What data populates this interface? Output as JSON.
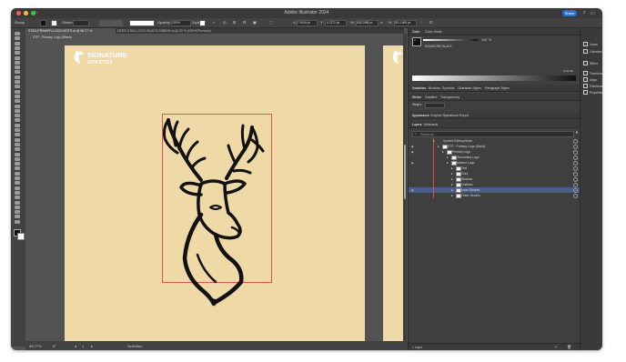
{
  "app": {
    "title": "Adobe Illustrator 2024",
    "share_label": "Share",
    "traffic_lights": [
      "#ff5f57",
      "#febc2e",
      "#28c840"
    ]
  },
  "control_bar": {
    "selection": "Group",
    "stroke_label": "Stroke:",
    "opacity_label": "Opacity:",
    "opacity_value": "100%",
    "style_label": "Style:",
    "x_label": "X:",
    "x_value": "7.0049 px",
    "y_label": "Y:",
    "y_value": "-6.2272 px",
    "w_label": "W:",
    "w_value": "518.2088 px",
    "h_label": "H:",
    "h_value": "811.1469 px"
  },
  "tabs": [
    {
      "label": "STAG-PRIMARY-LOGO-NOTE.ai @ 56.77 % (CMYK/Preview)",
      "active": true
    },
    {
      "label": "DEER-STAG-LOGO-BLACK-RIBBON.ai @ 20 % (CMYK/Preview)",
      "active": false
    }
  ],
  "artboard": {
    "label": "STP - Primary Logo (Stack)",
    "background": "#efd9a6"
  },
  "logo": {
    "brand_top": "SIGNATURE",
    "brand_bottom": "ATHLETICS"
  },
  "status": {
    "zoom": "56.77%",
    "rotation": "0°",
    "artboard_num": "1",
    "tool": "Selection"
  },
  "panel": {
    "color_tabs": [
      "Color",
      "Color Guide"
    ],
    "swatch_name": "SIGNATURE BLACK",
    "tint_label": "C",
    "tint_value": "100",
    "tint_percent": "%",
    "hex_value": "1C1F1E",
    "swatch_tabs": [
      "Swatches",
      "Brushes",
      "Symbols",
      "Character Styles",
      "Paragraph Styles"
    ],
    "stroke_tabs": [
      "Stroke",
      "Gradient",
      "Transparency"
    ],
    "weight_label": "Weight:",
    "appearance_tabs": [
      "Appearance",
      "Graphic Styles",
      "Asset Export"
    ],
    "layers_tabs": [
      "Layers",
      "Artboards"
    ],
    "search_placeholder": "Search All",
    "footer": "1 Layer"
  },
  "layers": [
    {
      "name": "Symbol Editing Mode",
      "indent": 1,
      "sel": false,
      "swatch": false,
      "eye": false
    },
    {
      "name": "STP - Primary Logo (Stack)",
      "indent": 2,
      "sel": false,
      "swatch": true,
      "eye": true
    },
    {
      "name": "Primary Logo",
      "indent": 3,
      "sel": false,
      "swatch": true,
      "eye": true
    },
    {
      "name": "Secondary Logo",
      "indent": 4,
      "sel": false,
      "swatch": true,
      "eye": false
    },
    {
      "name": "Mascot Logo",
      "indent": 4,
      "sel": false,
      "swatch": true,
      "eye": true
    },
    {
      "name": "Text",
      "indent": 5,
      "sel": false,
      "swatch": true,
      "eye": false
    },
    {
      "name": "Gold",
      "indent": 5,
      "sel": false,
      "swatch": true,
      "eye": false
    },
    {
      "name": "Shadow",
      "indent": 5,
      "sel": false,
      "swatch": true,
      "eye": false
    },
    {
      "name": "Outlines",
      "indent": 5,
      "sel": false,
      "swatch": true,
      "eye": false
    },
    {
      "name": "Inner Strokes",
      "indent": 5,
      "sel": true,
      "swatch": true,
      "eye": true
    },
    {
      "name": "Outer Strokes",
      "indent": 5,
      "sel": false,
      "swatch": true,
      "eye": false
    }
  ],
  "right_bar": [
    {
      "label": "Learn",
      "icon": "learn-icon"
    },
    {
      "label": "Libraries",
      "icon": "libraries-icon"
    },
    {
      "label": "Effect",
      "icon": "effect-icon"
    },
    {
      "label": "Transform",
      "icon": "transform-icon"
    },
    {
      "label": "Align",
      "icon": "align-icon"
    },
    {
      "label": "Pathfinder",
      "icon": "pathfinder-icon"
    },
    {
      "label": "Properties",
      "icon": "properties-icon"
    }
  ]
}
